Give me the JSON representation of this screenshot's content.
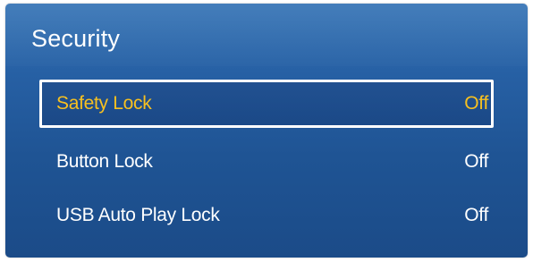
{
  "menu": {
    "title": "Security",
    "items": [
      {
        "label": "Safety Lock",
        "value": "Off"
      },
      {
        "label": "Button Lock",
        "value": "Off"
      },
      {
        "label": "USB Auto Play Lock",
        "value": "Off"
      }
    ],
    "selected_index": 0
  },
  "colors": {
    "background": "#2565a8",
    "selected_text": "#f7c020",
    "text": "#ffffff",
    "focus_border": "#ffffff"
  }
}
